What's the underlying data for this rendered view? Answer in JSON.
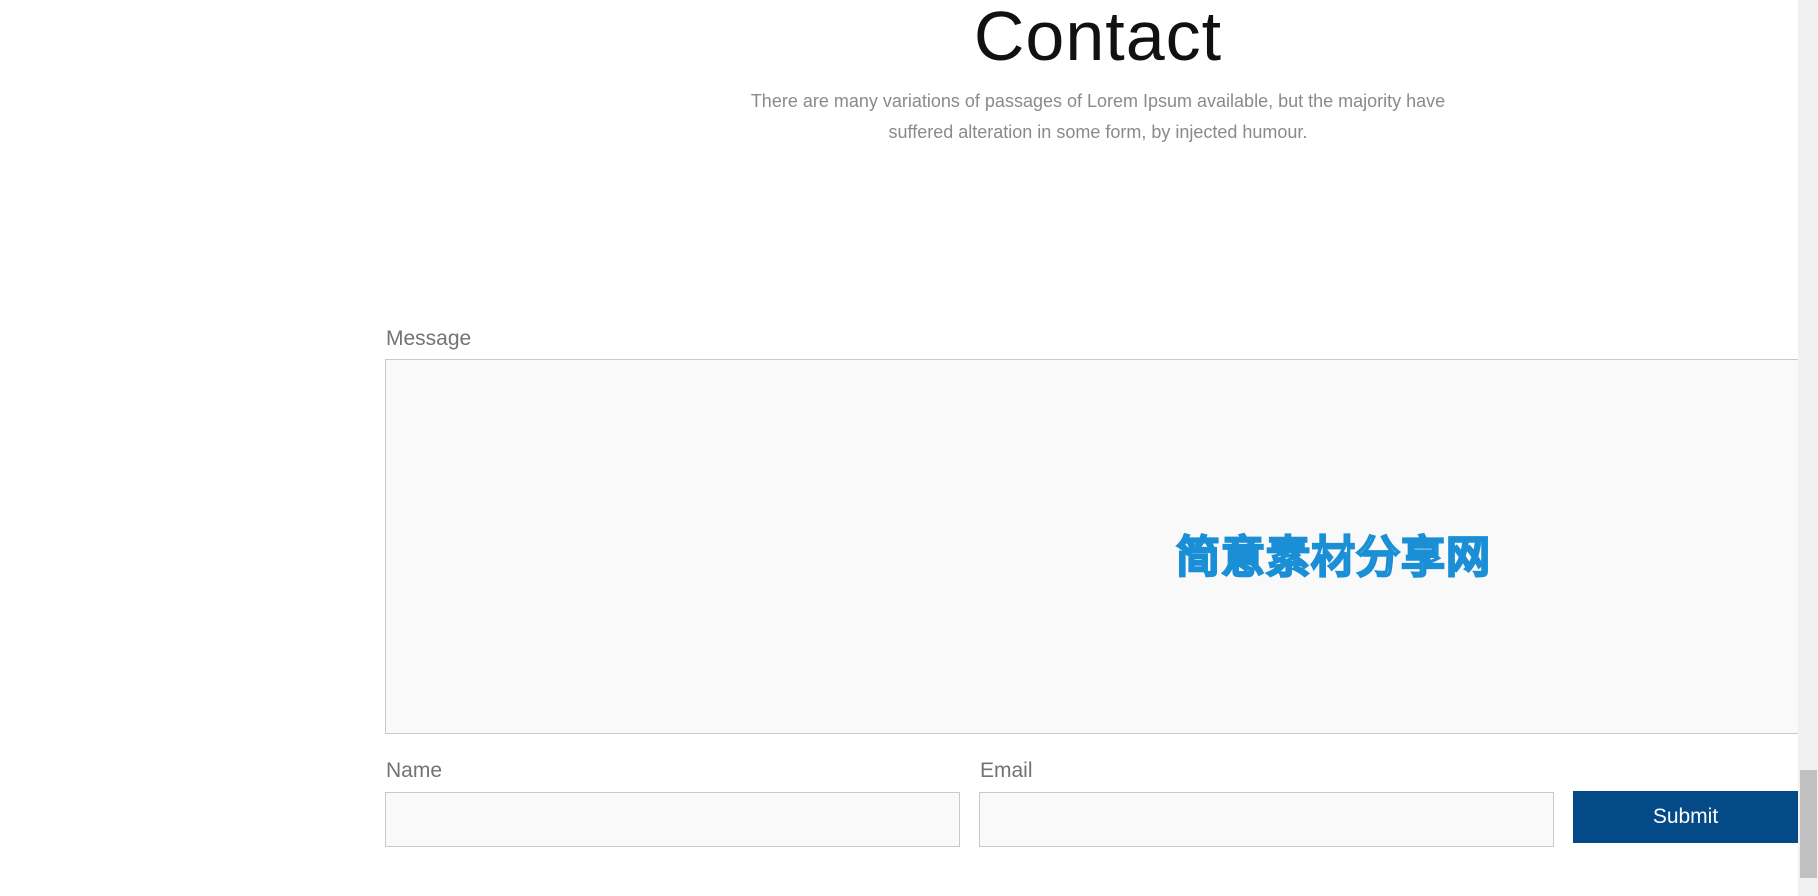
{
  "contact": {
    "title": "Contact",
    "subtitle": "There are many variations of passages of Lorem Ipsum available, but the majority have suffered alteration in some form, by injected humour."
  },
  "form": {
    "message_label": "Message",
    "message_value": "",
    "name_label": "Name",
    "name_value": "",
    "email_label": "Email",
    "email_value": "",
    "submit_label": "Submit"
  },
  "watermark": {
    "text": "简意素材分享网"
  },
  "colors": {
    "submit_bg": "#044a87",
    "field_bg": "#f9f9f9",
    "field_border": "#c9c9c9",
    "watermark_outline": "#1a8fd6"
  }
}
